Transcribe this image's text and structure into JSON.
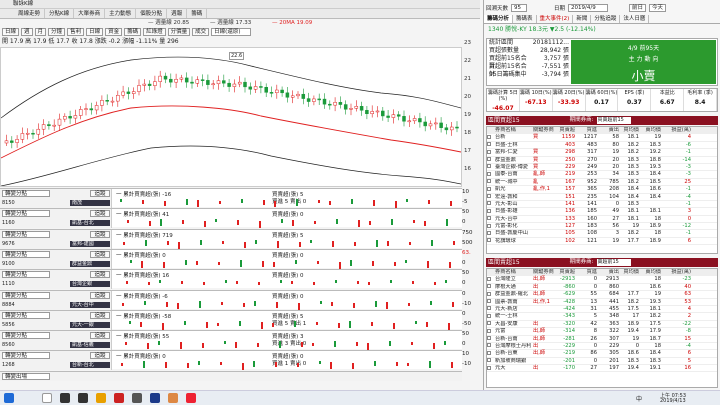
{
  "left": {
    "title": "聯詠K線",
    "tabs": [
      "周線走勢",
      "分點K線",
      "大單券商",
      "主力動態",
      "個股分點",
      "週報",
      "籌碼"
    ],
    "legend": [
      {
        "label": "週量線 20.85",
        "color": "#333"
      },
      {
        "label": "週量線 17.33",
        "color": "#333"
      },
      {
        "label": "20MA 19.09",
        "color": "#e02020"
      }
    ],
    "toolbar": [
      "日線",
      "週",
      "月",
      "分鐘",
      "售利",
      "日線",
      "資金",
      "籌碼",
      "紅綠燈",
      "分價量",
      "成交"
    ],
    "toolbar_select": "日線(還原)",
    "info": "開 17.9  高 17.9  低 17.7  收 17.8  漲跌 -0.2  漲幅 -1.11%  量 296",
    "y_labels": [
      "23",
      "22",
      "21",
      "20",
      "19",
      "18",
      "17",
      "16"
    ],
    "annotation": "22.6",
    "sub_charts": [
      {
        "sel": "轉變分點",
        "btn": "追蹤",
        "code": "8150",
        "tag": "南茂",
        "t1": "一 累計買賣超(張) -16",
        "t2": "買賣超(張) 5",
        "t3": "買進 5 賣出 0",
        "y1": "10",
        "y2": "-5"
      },
      {
        "sel": "轉變分點",
        "btn": "追蹤",
        "code": "1160",
        "tag": "凱基-台北",
        "t1": "一 累計買賣超(張) 41",
        "t2": "買賣超(張) 0",
        "t3": "",
        "y1": "50",
        "y2": "0"
      },
      {
        "sel": "轉變分點",
        "btn": "追蹤",
        "code": "9676",
        "tag": "富邦-建國",
        "t1": "一 累計買賣超(張) 719",
        "t2": "買賣超(張) 5",
        "t3": "",
        "y1": "750",
        "y2": "500"
      },
      {
        "sel": "轉變分點",
        "btn": "追蹤",
        "code": "9100",
        "tag": "群益金鼎",
        "t1": "一 累計買賣超(張) 0",
        "t2": "買賣超(張) 0",
        "t3": "",
        "y1": "63.",
        "y2": "0"
      },
      {
        "sel": "轉變分點",
        "btn": "追蹤",
        "code": "1110",
        "tag": "台灣企銀",
        "t1": "一 累計買賣超(張) 16",
        "t2": "買賣超(張) 0",
        "t3": "",
        "y1": "50",
        "y2": "0"
      },
      {
        "sel": "轉變分點",
        "btn": "追蹤",
        "code": "8884",
        "tag": "元大-台中",
        "t1": "一 累計買賣超(張) -6",
        "t2": "買賣超(張) 0",
        "t3": "",
        "y1": "0",
        "y2": "-10"
      },
      {
        "sel": "轉變分點",
        "btn": "追蹤",
        "code": "5856",
        "tag": "元大-一銀",
        "t1": "一 累計買賣超(張) -58",
        "t2": "買賣超(張) 5",
        "t3": "買進 5 賣出 1",
        "y1": "0",
        "y2": "-50"
      },
      {
        "sel": "轉變分點",
        "btn": "追蹤",
        "code": "8560",
        "tag": "凱基-信義",
        "t1": "一 累計買賣超(張) 55",
        "t2": "買賣超(張) 3",
        "t3": "買進 3 賣出 0",
        "y1": "50",
        "y2": "0"
      },
      {
        "sel": "轉變分點",
        "btn": "追蹤",
        "code": "1268",
        "tag": "台新-台北",
        "t1": "一 累計買賣超(張) 0",
        "t2": "買賣超(張) 0",
        "t3": "買進 1 賣出 0",
        "y1": "10",
        "y2": "-10"
      }
    ],
    "bottom_sel": "轉變出場"
  },
  "right": {
    "label_lookback": "回溯天數",
    "days": "95",
    "label_date": "日期",
    "date": "2019/4/9",
    "nav_prev": "前日",
    "nav_next": "今天",
    "tabs": [
      "籌碼分析",
      "籌碼表",
      "重大事件(2)",
      "新聞",
      "分點追蹤",
      "法人日曆"
    ],
    "stock": "1340  勝悅-KY  18.3元  ▼2.5  (-12.14%)",
    "kv": [
      {
        "k": "統計區間",
        "v": "20181112..."
      },
      {
        "k": "買超張數量",
        "v": "28,942 張"
      },
      {
        "k": "買超前15名合計",
        "v": "3,757 張"
      },
      {
        "k": "賣超前15名合計",
        "v": "-7,551 張"
      },
      {
        "k": "95日籌碼集中",
        "v": "-3,794 張"
      }
    ],
    "green_date": "4/9 前95天",
    "green_label": "主 力 動 向",
    "green_big": "小賣",
    "stats": [
      {
        "h": "籌碼計算 5日(%)",
        "v": "-46.07"
      },
      {
        "h": "籌碼 10日(%)",
        "v": "-67.13"
      },
      {
        "h": "籌碼 20日(%)",
        "v": "-33.93"
      },
      {
        "h": "籌碼 60日(%)",
        "v": "0.17"
      },
      {
        "h": "EPS (季)",
        "v": "0.37"
      },
      {
        "h": "本益比",
        "v": "6.67"
      },
      {
        "h": "毛利率 (季)",
        "v": "8.4"
      }
    ],
    "buy_title": "區間買超15",
    "buy_label": "期間券商:",
    "buy_sel": "買賣超前15",
    "headers": [
      "",
      "券商名稱",
      "關鍵券商",
      "買賣超",
      "買進",
      "賣出",
      "買均價",
      "賣均價",
      "損益(萬)"
    ],
    "buy_rows": [
      [
        "台新",
        "買",
        "1159",
        "1217",
        "58",
        "18.1",
        "19",
        "4"
      ],
      [
        "日盛-士林",
        "",
        "403",
        "483",
        "80",
        "18.2",
        "18.3",
        "-6"
      ],
      [
        "富邦-仁愛",
        "買",
        "298",
        "317",
        "19",
        "18.2",
        "19.2",
        "-1"
      ],
      [
        "群益金鼎",
        "買",
        "250",
        "270",
        "20",
        "18.3",
        "18.8",
        "-14"
      ],
      [
        "臺灣企銀-博愛",
        "買",
        "229",
        "249",
        "20",
        "18.3",
        "19.3",
        "-3"
      ],
      [
        "國泰-台南",
        "亂,師",
        "219",
        "253",
        "34",
        "18.3",
        "18.4",
        "-3"
      ],
      [
        "統一-城中",
        "亂",
        "167",
        "952",
        "785",
        "18.2",
        "18.5",
        "25"
      ],
      [
        "凱光",
        "亂,作,1",
        "157",
        "365",
        "208",
        "18.4",
        "18.6",
        "-1"
      ],
      [
        "宏遠-敦和",
        "",
        "151",
        "235",
        "104",
        "18.4",
        "18.4",
        "-4"
      ],
      [
        "元大-彰山",
        "",
        "141",
        "141",
        "0",
        "18.3",
        "",
        "-1"
      ],
      [
        "日盛-彰雄",
        "",
        "136",
        "185",
        "49",
        "18.1",
        "18.1",
        "3"
      ],
      [
        "元大-台中",
        "",
        "133",
        "160",
        "27",
        "18.1",
        "18",
        "0"
      ],
      [
        "元富-彰化",
        "",
        "127",
        "183",
        "56",
        "19",
        "18.9",
        "-12"
      ],
      [
        "日盛-敦慶中山",
        "",
        "105",
        "108",
        "3",
        "18.2",
        "18",
        "-1"
      ],
      [
        "花旗環球",
        "",
        "102",
        "121",
        "19",
        "17.7",
        "18.9",
        "6"
      ]
    ],
    "sell_title": "區間賣超15",
    "sell_label": "期間券商:",
    "sell_sel": "賣超前15",
    "sell_rows": [
      [
        "台灣隆立",
        "出,師",
        "-2913",
        "0",
        "2913",
        "",
        "18",
        "-23"
      ],
      [
        "摩根大通",
        "出",
        "-860",
        "0",
        "860",
        "",
        "18.6",
        "40"
      ],
      [
        "群益金鼎-羅北",
        "出,師",
        "-629",
        "55",
        "684",
        "17.7",
        "19",
        "63"
      ],
      [
        "國票-敦南",
        "出,作,1",
        "-428",
        "13",
        "441",
        "18.2",
        "19.3",
        "53"
      ],
      [
        "元大-新店",
        "",
        "-424",
        "31",
        "455",
        "17.5",
        "18.1",
        "4"
      ],
      [
        "統一-士林",
        "",
        "-343",
        "5",
        "348",
        "17",
        "18.2",
        "2"
      ],
      [
        "大昌-安康",
        "出",
        "-320",
        "42",
        "363",
        "18.9",
        "17.5",
        "-22"
      ],
      [
        "元富",
        "出,師",
        "-314",
        "8",
        "322",
        "19.4",
        "17.9",
        "-8"
      ],
      [
        "台新-台南",
        "出,師",
        "-281",
        "26",
        "307",
        "19",
        "18.7",
        "15"
      ],
      [
        "台灣摩根士丹利",
        "出",
        "-229",
        "0",
        "229",
        "0",
        "18",
        "-4"
      ],
      [
        "台新-台東",
        "出,師",
        "-219",
        "86",
        "305",
        "18.6",
        "18.4",
        "6"
      ],
      [
        "新加坡商瑞銀",
        "",
        "-201",
        "0",
        "201",
        "18.3",
        "18.3",
        "5"
      ],
      [
        "元大",
        "出",
        "-170",
        "27",
        "197",
        "19.4",
        "19.1",
        "16"
      ]
    ]
  },
  "taskbar": {
    "time": "上午 07:53",
    "date": "2019/4/13",
    "lang": "中"
  },
  "colors": {
    "up": "#e02020",
    "down": "#1a9a3a",
    "header": "#8a1020",
    "green_box": "#2c9a2e"
  }
}
